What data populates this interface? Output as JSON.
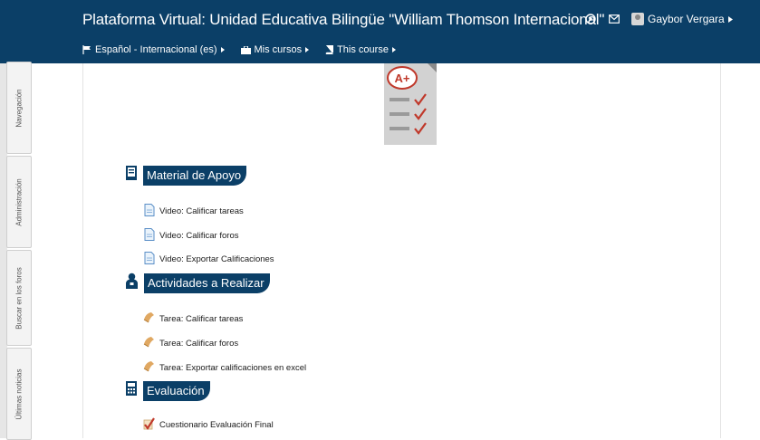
{
  "header": {
    "site_title": "Plataforma Virtual: Unidad Educativa Bilingüe \"William Thomson Internacional\"",
    "user_name": "Gaybor Vergara",
    "icons": [
      "help-icon",
      "mail-icon"
    ]
  },
  "nav": {
    "language": "Español - Internacional (es)",
    "my_courses": "Mis cursos",
    "this_course": "This course"
  },
  "side_blocks": [
    {
      "label": "Navegación"
    },
    {
      "label": "Administración"
    },
    {
      "label": "Buscar en los foros"
    },
    {
      "label": "Últimas noticias"
    }
  ],
  "sections": [
    {
      "title": "Material de Apoyo",
      "icon": "document-icon",
      "items": [
        {
          "label": "Video: Calificar tareas",
          "icon": "file-icon"
        },
        {
          "label": "Video: Calificar foros",
          "icon": "file-icon"
        },
        {
          "label": "Video: Exportar Calificaciones",
          "icon": "file-icon"
        }
      ]
    },
    {
      "title": "Actividades a Realizar",
      "icon": "teacher-icon",
      "items": [
        {
          "label": "Tarea: Calificar tareas",
          "icon": "assignment-icon"
        },
        {
          "label": "Tarea: Calificar foros",
          "icon": "assignment-icon"
        },
        {
          "label": "Tarea: Exportar calificaciones en excel",
          "icon": "assignment-icon"
        }
      ]
    },
    {
      "title": "Evaluación",
      "icon": "calculator-icon",
      "items": [
        {
          "label": "Cuestionario Evaluación Final",
          "icon": "quiz-icon"
        }
      ]
    }
  ],
  "banner": {
    "grade_text": "A+"
  },
  "colors": {
    "header": "#0b3f67",
    "section_label": "#0b3f67",
    "check": "#c0392b"
  }
}
